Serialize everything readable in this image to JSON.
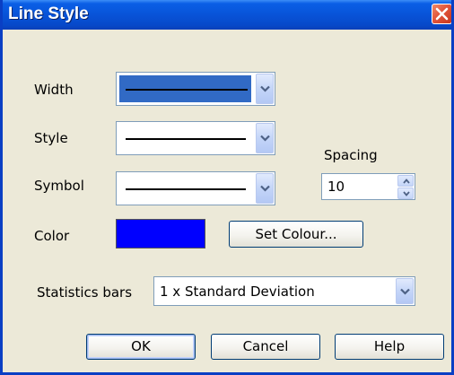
{
  "dialog": {
    "title": "Line Style",
    "close_icon": "close-icon"
  },
  "fields": {
    "width_label": "Width",
    "style_label": "Style",
    "symbol_label": "Symbol",
    "color_label": "Color",
    "spacing_label": "Spacing",
    "spacing_value": "10",
    "statistics_label": "Statistics bars",
    "statistics_value": "1 x Standard Deviation"
  },
  "color": {
    "swatch": "#0000ff"
  },
  "buttons": {
    "set_colour": "Set Colour...",
    "ok": "OK",
    "cancel": "Cancel",
    "help": "Help"
  },
  "colors": {
    "title_bar": "#0853d8",
    "dialog_bg": "#ece9d8",
    "selection": "#316ac5",
    "close_button": "#e2553a"
  }
}
